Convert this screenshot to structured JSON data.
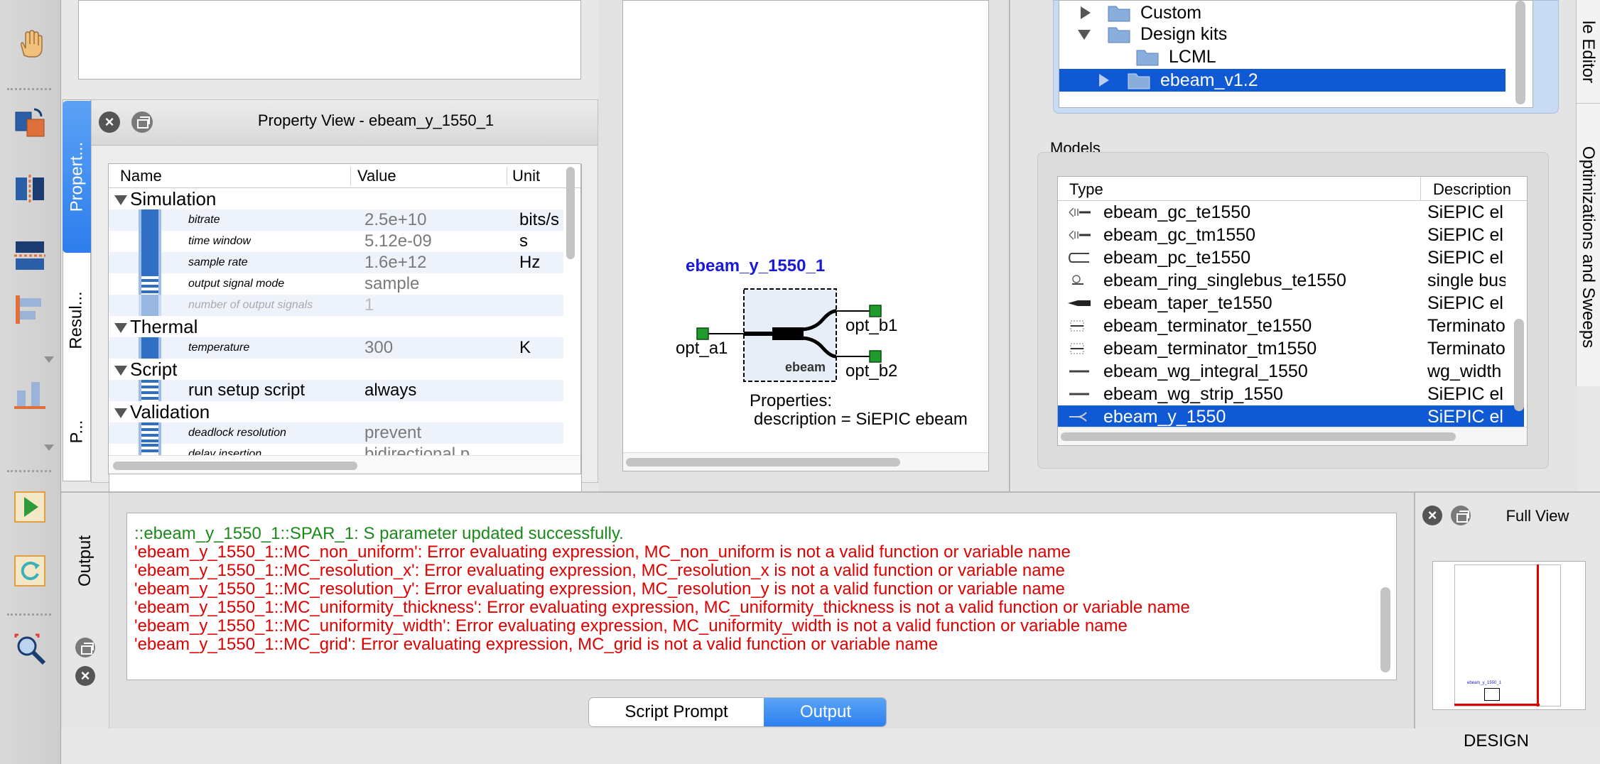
{
  "property_view": {
    "title": "Property View - ebeam_y_1550_1",
    "columns": {
      "name": "Name",
      "value": "Value",
      "unit": "Unit"
    },
    "groups": {
      "simulation": "Simulation",
      "thermal": "Thermal",
      "script": "Script",
      "validation": "Validation"
    },
    "rows": {
      "bitrate": {
        "name": "bitrate",
        "value": "2.5e+10",
        "unit": "bits/s"
      },
      "time_window": {
        "name": "time window",
        "value": "5.12e-09",
        "unit": "s"
      },
      "sample_rate": {
        "name": "sample rate",
        "value": "1.6e+12",
        "unit": "Hz"
      },
      "output_signal_mode": {
        "name": "output signal mode",
        "value": "sample",
        "unit": ""
      },
      "number_of_output_signals": {
        "name": "number of output signals",
        "value": "1",
        "unit": ""
      },
      "temperature": {
        "name": "temperature",
        "value": "300",
        "unit": "K"
      },
      "run_setup_script": {
        "name": "run setup script",
        "value": "always",
        "unit": ""
      },
      "deadlock_resolution": {
        "name": "deadlock resolution",
        "value": "prevent",
        "unit": ""
      },
      "delay_insertion": {
        "name": "delay insertion",
        "value": "bidirectional p",
        "unit": ""
      }
    }
  },
  "left_tabs": {
    "properties": "Propert...",
    "results": "Resul...",
    "p": "P..."
  },
  "schematic": {
    "element_name": "ebeam_y_1550_1",
    "block_label": "ebeam",
    "ports": {
      "a1": "opt_a1",
      "b1": "opt_b1",
      "b2": "opt_b2"
    },
    "properties_heading": "Properties:",
    "properties_line": "description = SiEPIC ebeam"
  },
  "library_tree": {
    "items": {
      "custom": "Custom",
      "design_kits": "Design kits",
      "lcml": "LCML",
      "ebeam": "ebeam_v1.2"
    }
  },
  "models": {
    "title": "Models",
    "columns": {
      "type": "Type",
      "description": "Description"
    },
    "rows": [
      {
        "type": "ebeam_gc_te1550",
        "desc": "SiEPIC el",
        "icon": "grating-coupler-icon"
      },
      {
        "type": "ebeam_gc_tm1550",
        "desc": "SiEPIC el",
        "icon": "grating-coupler-icon"
      },
      {
        "type": "ebeam_pc_te1550",
        "desc": "SiEPIC el",
        "icon": "polarization-icon"
      },
      {
        "type": "ebeam_ring_singlebus_te1550",
        "desc": "single bus",
        "icon": "ring-icon"
      },
      {
        "type": "ebeam_taper_te1550",
        "desc": "SiEPIC el",
        "icon": "taper-icon"
      },
      {
        "type": "ebeam_terminator_te1550",
        "desc": "Terminato",
        "icon": "terminator-icon"
      },
      {
        "type": "ebeam_terminator_tm1550",
        "desc": "Terminato",
        "icon": "terminator-icon"
      },
      {
        "type": "ebeam_wg_integral_1550",
        "desc": "wg_width",
        "icon": "waveguide-icon"
      },
      {
        "type": "ebeam_wg_strip_1550",
        "desc": "SiEPIC el",
        "icon": "waveguide-icon"
      },
      {
        "type": "ebeam_y_1550",
        "desc": "SiEPIC el",
        "icon": "y-branch-icon",
        "selected": true
      }
    ]
  },
  "right_tabs": {
    "element_editor": "le Editor",
    "optimizations": "Optimizations and Sweeps"
  },
  "output": {
    "tab_label": "Output",
    "lines": [
      {
        "kind": "ok",
        "text": "::ebeam_y_1550_1::SPAR_1: S parameter updated successfully."
      },
      {
        "kind": "err",
        "text": "'ebeam_y_1550_1::MC_non_uniform': Error evaluating expression, MC_non_uniform is not a valid function or variable name"
      },
      {
        "kind": "err",
        "text": "'ebeam_y_1550_1::MC_resolution_x': Error evaluating expression, MC_resolution_x is not a valid function or variable name"
      },
      {
        "kind": "err",
        "text": "'ebeam_y_1550_1::MC_resolution_y': Error evaluating expression, MC_resolution_y is not a valid function or variable name"
      },
      {
        "kind": "err",
        "text": "'ebeam_y_1550_1::MC_uniformity_thickness': Error evaluating expression, MC_uniformity_thickness is not a valid function or variable name"
      },
      {
        "kind": "err",
        "text": "'ebeam_y_1550_1::MC_uniformity_width': Error evaluating expression, MC_uniformity_width is not a valid function or variable name"
      },
      {
        "kind": "err",
        "text": "'ebeam_y_1550_1::MC_grid': Error evaluating expression, MC_grid is not a valid function or variable name"
      }
    ]
  },
  "bottom_tabs": {
    "script_prompt": "Script Prompt",
    "output": "Output"
  },
  "full_view": {
    "title": "Full View",
    "thumb_label": "ebeam_y_1550_1",
    "status": "DESIGN"
  },
  "colors": {
    "selection": "#0f5ad4",
    "ok_text": "#1b8a1b",
    "error_text": "#e00000",
    "schematic_title": "#1a1ad6"
  }
}
